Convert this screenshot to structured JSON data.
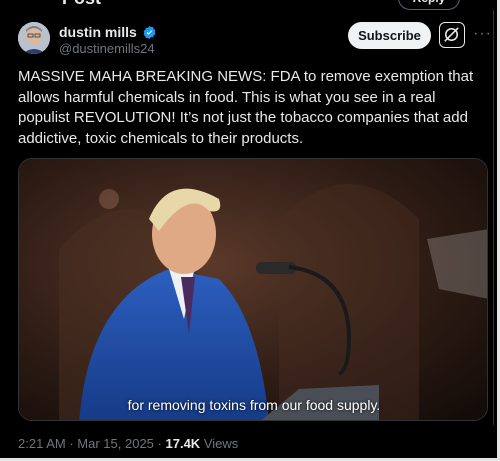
{
  "header": {
    "title": "Post",
    "reply_label": "Reply",
    "more": "···"
  },
  "author": {
    "name": "dustin mills",
    "handle": "@dustinemills24",
    "verified": true
  },
  "actions": {
    "subscribe_label": "Subscribe",
    "more": "···"
  },
  "tweet": {
    "text": "MASSIVE MAHA BREAKING NEWS: FDA to remove exemption that allows harmful chemicals in food. This is what you see in a real populist REVOLUTION! It’s not just the tobacco companies that add addictive, toxic chemicals to their products."
  },
  "media": {
    "caption": "for removing toxins from our food supply."
  },
  "meta": {
    "time": "2:21 AM",
    "date": "Mar 15, 2025",
    "views_count": "17.4K",
    "views_label": "Views",
    "separator": "·"
  },
  "colors": {
    "background": "#000000",
    "text": "#e7e9ea",
    "muted": "#71767b",
    "verified": "#1d9bf0",
    "suit": "#1f4ea8"
  }
}
